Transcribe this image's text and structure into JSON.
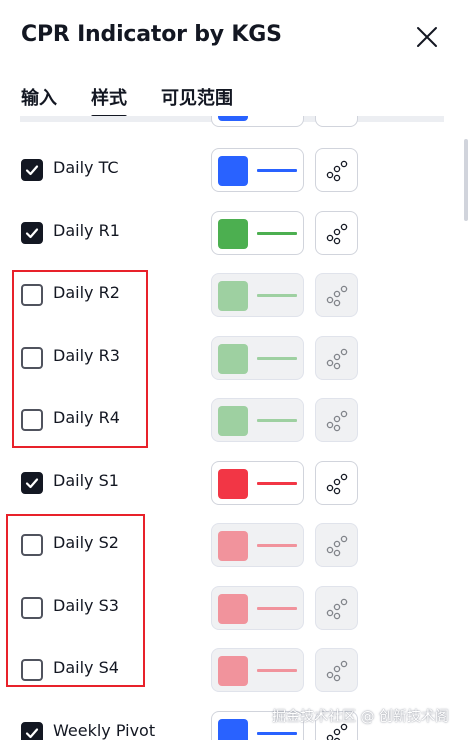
{
  "dialog": {
    "title": "CPR Indicator by KGS",
    "close_icon": "close-icon"
  },
  "tabs": [
    {
      "label": "输入",
      "active": false
    },
    {
      "label": "样式",
      "active": true
    },
    {
      "label": "可见范围",
      "active": false
    }
  ],
  "rows": [
    {
      "label": "Daily TC",
      "checked": true,
      "color": "#2962ff",
      "dimmed": false
    },
    {
      "label": "Daily R1",
      "checked": true,
      "color": "#4caf50",
      "dimmed": false
    },
    {
      "label": "Daily R2",
      "checked": false,
      "color": "#4caf50",
      "dimmed": true
    },
    {
      "label": "Daily R3",
      "checked": false,
      "color": "#4caf50",
      "dimmed": true
    },
    {
      "label": "Daily R4",
      "checked": false,
      "color": "#4caf50",
      "dimmed": true
    },
    {
      "label": "Daily S1",
      "checked": true,
      "color": "#f23645",
      "dimmed": false
    },
    {
      "label": "Daily S2",
      "checked": false,
      "color": "#f23645",
      "dimmed": true
    },
    {
      "label": "Daily S3",
      "checked": false,
      "color": "#f23645",
      "dimmed": true
    },
    {
      "label": "Daily S4",
      "checked": false,
      "color": "#f23645",
      "dimmed": true
    },
    {
      "label": "Weekly Pivot",
      "checked": true,
      "color": "#2962ff",
      "dimmed": false
    }
  ],
  "colors": {
    "highlight_box": "#e8212a",
    "text": "#131722"
  },
  "watermark": "掘金技术社区 @ 创新技术阁"
}
